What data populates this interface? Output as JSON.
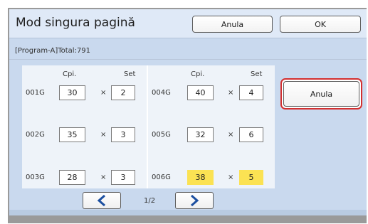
{
  "dialog": {
    "title": "Mod singura pagină",
    "cancel_label": "Anula",
    "ok_label": "OK"
  },
  "program": {
    "summary": "[Program-A]Total:791"
  },
  "table": {
    "columns": {
      "cpi": "Cpi.",
      "set": "Set"
    },
    "multiply_sign": "×",
    "left": [
      {
        "id": "001G",
        "cpi": "30",
        "set": "2"
      },
      {
        "id": "002G",
        "cpi": "35",
        "set": "3"
      },
      {
        "id": "003G",
        "cpi": "28",
        "set": "3"
      }
    ],
    "right": [
      {
        "id": "004G",
        "cpi": "40",
        "set": "4"
      },
      {
        "id": "005G",
        "cpi": "32",
        "set": "6"
      },
      {
        "id": "006G",
        "cpi": "38",
        "set": "5",
        "highlighted": true
      }
    ]
  },
  "side_action": {
    "label": "Anula"
  },
  "pager": {
    "indicator": "1/2",
    "prev_icon": "chevron-left-icon",
    "next_icon": "chevron-right-icon"
  },
  "colors": {
    "highlight": "#fbe253",
    "panel": "#c9d9ee",
    "selected_border": "#d32f2f",
    "arrow": "#1b4fa0"
  }
}
